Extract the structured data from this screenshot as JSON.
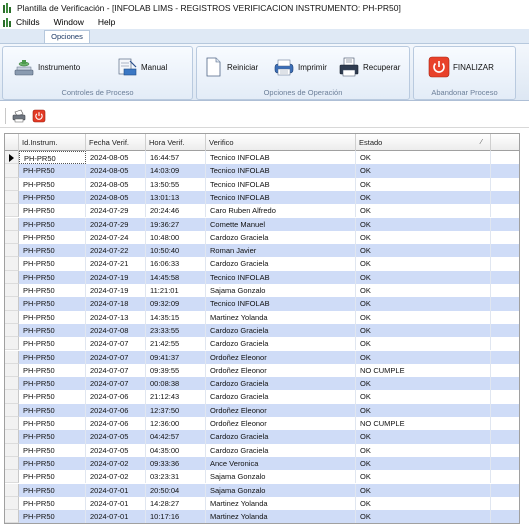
{
  "window": {
    "title": "Plantilla de Verificación  -  [INFOLAB LIMS - REGISTROS VERIFICACION INSTRUMENTO: PH-PR50]"
  },
  "menu": {
    "items": [
      "Childs",
      "Window",
      "Help"
    ]
  },
  "ribbon": {
    "tab": "Opciones",
    "groups": {
      "controles": {
        "label": "Controles de Proceso",
        "instrumento": "Instrumento",
        "manual": "Manual"
      },
      "operacion": {
        "label": "Opciones de Operación",
        "reiniciar": "Reiniciar",
        "imprimir": "Imprimir",
        "recuperar": "Recuperar"
      },
      "abandonar": {
        "label": "Abandonar Proceso",
        "finalizar": "FINALIZAR"
      }
    }
  },
  "toolbar": {
    "icons": [
      "print-icon",
      "stop-icon"
    ]
  },
  "grid": {
    "columns": [
      "Id.Instrum.",
      "Fecha Verif.",
      "Hora Verif.",
      "Verifico",
      "Estado"
    ],
    "rows": [
      [
        "PH-PR50",
        "2024-08-05",
        "16:44:57",
        "Tecnico INFOLAB",
        "OK"
      ],
      [
        "PH-PR50",
        "2024-08-05",
        "14:03:09",
        "Tecnico INFOLAB",
        "OK"
      ],
      [
        "PH-PR50",
        "2024-08-05",
        "13:50:55",
        "Tecnico INFOLAB",
        "OK"
      ],
      [
        "PH-PR50",
        "2024-08-05",
        "13:01:13",
        "Tecnico INFOLAB",
        "OK"
      ],
      [
        "PH-PR50",
        "2024-07-29",
        "20:24:46",
        "Caro Ruben Alfredo",
        "OK"
      ],
      [
        "PH-PR50",
        "2024-07-29",
        "19:36:27",
        "Comette Manuel",
        "OK"
      ],
      [
        "PH-PR50",
        "2024-07-24",
        "10:48:00",
        "Cardozo Graciela",
        "OK"
      ],
      [
        "PH-PR50",
        "2024-07-22",
        "10:50:40",
        "Roman Javier",
        "OK"
      ],
      [
        "PH-PR50",
        "2024-07-21",
        "16:06:33",
        "Cardozo Graciela",
        "OK"
      ],
      [
        "PH-PR50",
        "2024-07-19",
        "14:45:58",
        "Tecnico INFOLAB",
        "OK"
      ],
      [
        "PH-PR50",
        "2024-07-19",
        "11:21:01",
        "Sajama Gonzalo",
        "OK"
      ],
      [
        "PH-PR50",
        "2024-07-18",
        "09:32:09",
        "Tecnico INFOLAB",
        "OK"
      ],
      [
        "PH-PR50",
        "2024-07-13",
        "14:35:15",
        "Martinez Yolanda",
        "OK"
      ],
      [
        "PH-PR50",
        "2024-07-08",
        "23:33:55",
        "Cardozo Graciela",
        "OK"
      ],
      [
        "PH-PR50",
        "2024-07-07",
        "21:42:55",
        "Cardozo Graciela",
        "OK"
      ],
      [
        "PH-PR50",
        "2024-07-07",
        "09:41:37",
        "Ordoñez Eleonor",
        "OK"
      ],
      [
        "PH-PR50",
        "2024-07-07",
        "09:39:55",
        "Ordoñez Eleonor",
        "NO CUMPLE"
      ],
      [
        "PH-PR50",
        "2024-07-07",
        "00:08:38",
        "Cardozo Graciela",
        "OK"
      ],
      [
        "PH-PR50",
        "2024-07-06",
        "21:12:43",
        "Cardozo Graciela",
        "OK"
      ],
      [
        "PH-PR50",
        "2024-07-06",
        "12:37:50",
        "Ordoñez Eleonor",
        "OK"
      ],
      [
        "PH-PR50",
        "2024-07-06",
        "12:36:00",
        "Ordoñez Eleonor",
        "NO CUMPLE"
      ],
      [
        "PH-PR50",
        "2024-07-05",
        "04:42:57",
        "Cardozo Graciela",
        "OK"
      ],
      [
        "PH-PR50",
        "2024-07-05",
        "04:35:00",
        "Cardozo Graciela",
        "OK"
      ],
      [
        "PH-PR50",
        "2024-07-02",
        "09:33:36",
        "Ance Veronica",
        "OK"
      ],
      [
        "PH-PR50",
        "2024-07-02",
        "03:23:31",
        "Sajama Gonzalo",
        "OK"
      ],
      [
        "PH-PR50",
        "2024-07-01",
        "20:50:04",
        "Sajama Gonzalo",
        "OK"
      ],
      [
        "PH-PR50",
        "2024-07-01",
        "14:28:27",
        "Martinez Yolanda",
        "OK"
      ],
      [
        "PH-PR50",
        "2024-07-01",
        "10:17:16",
        "Martinez Yolanda",
        "OK"
      ]
    ]
  },
  "colors": {
    "alt_row": "#cfdcf7",
    "ribbon": "#dde7f3",
    "finalizar_red": "#e8412a"
  }
}
